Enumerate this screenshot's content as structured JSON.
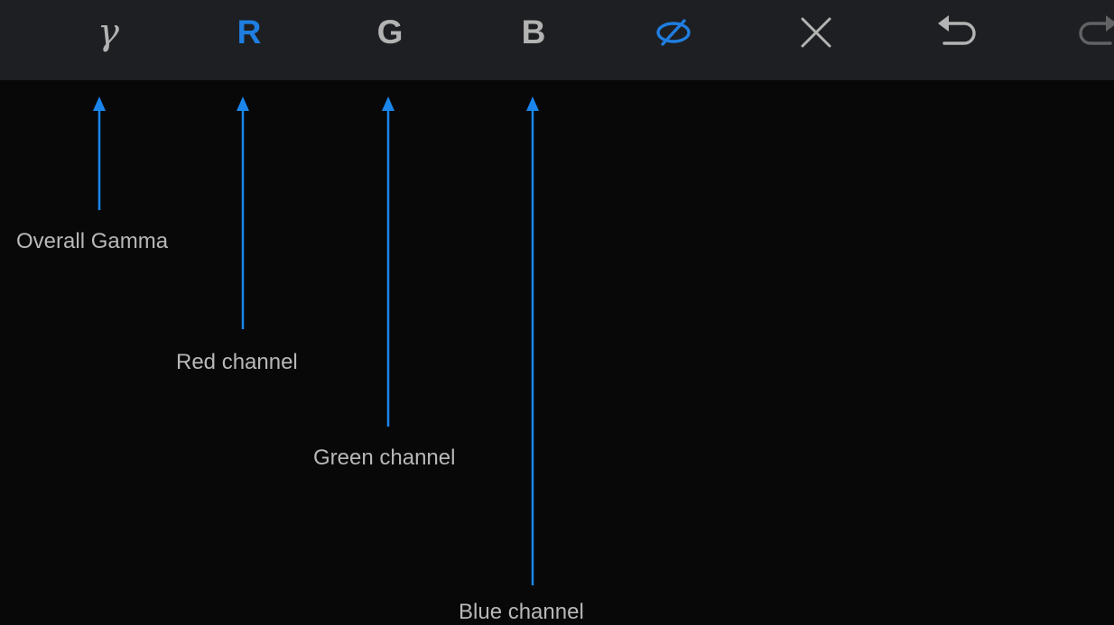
{
  "toolbar": {
    "items": [
      {
        "name": "gamma",
        "glyph": "γ",
        "active": false
      },
      {
        "name": "red",
        "glyph": "R",
        "active": true
      },
      {
        "name": "green",
        "glyph": "G",
        "active": false
      },
      {
        "name": "blue",
        "glyph": "B",
        "active": false
      },
      {
        "name": "hide-icon",
        "active": true
      },
      {
        "name": "close-icon",
        "active": false
      },
      {
        "name": "undo-icon",
        "active": false
      },
      {
        "name": "redo-icon",
        "active": false
      }
    ]
  },
  "callouts": {
    "gamma": "Overall Gamma",
    "red": "Red channel",
    "green": "Green channel",
    "blue": "Blue channel"
  },
  "colors": {
    "background": "#080809",
    "toolbar_background": "#1e1f22",
    "icon_default": "#b3b3b3",
    "icon_active": "#1f7ee0",
    "arrow": "#1a86ec",
    "label": "#b8b8b8"
  }
}
